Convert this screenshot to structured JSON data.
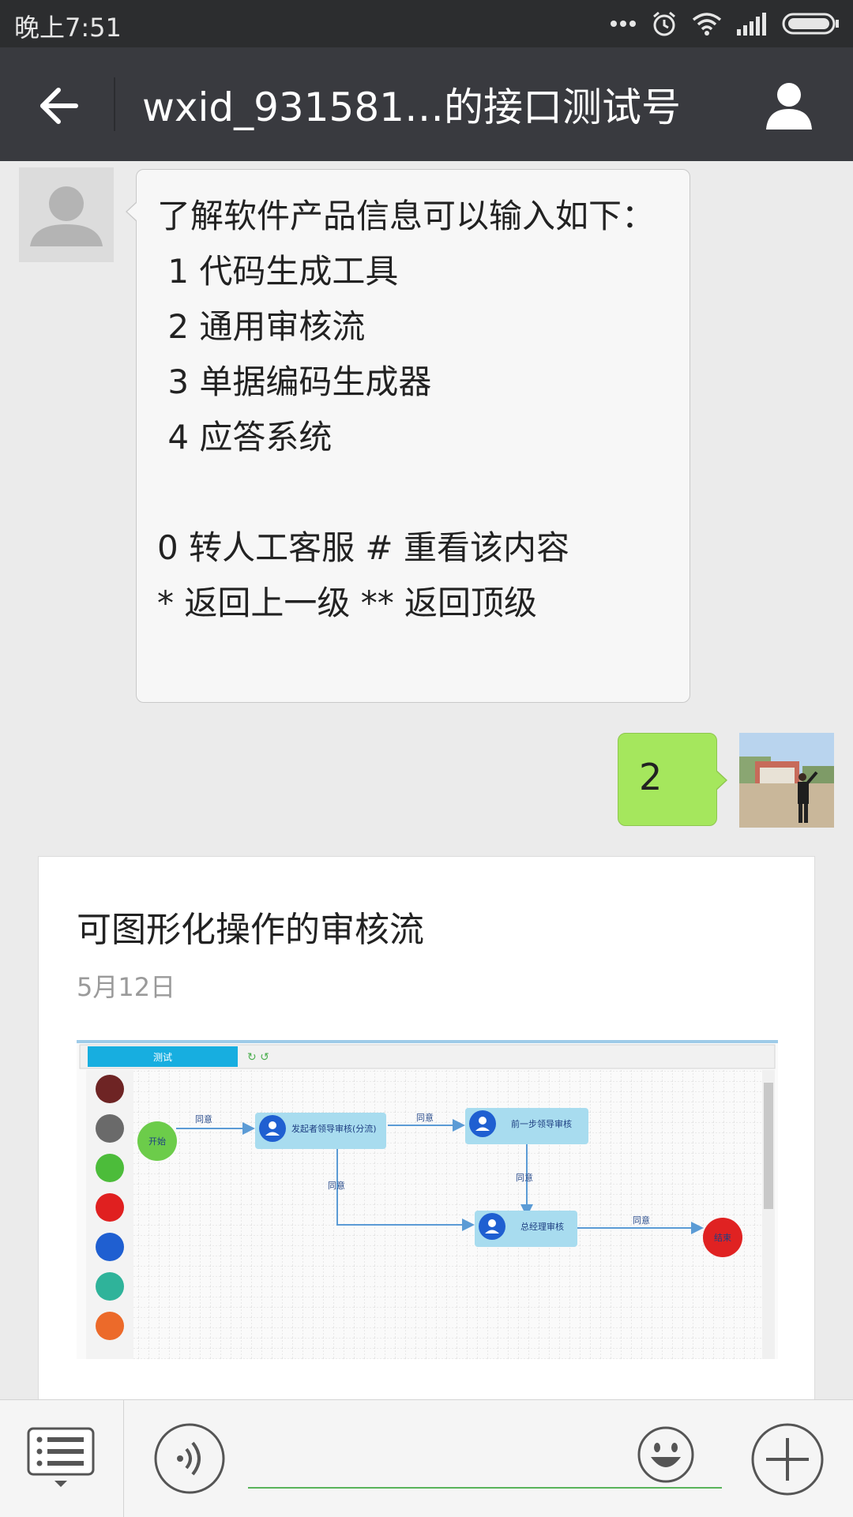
{
  "status_bar": {
    "time": "晚上7:51",
    "icons": [
      "more-dots-icon",
      "alarm-icon",
      "wifi-icon",
      "signal-icon",
      "battery-icon"
    ]
  },
  "header": {
    "title": "wxid_931581…的接口测试号",
    "icons": [
      "back-arrow-icon",
      "profile-icon"
    ],
    "background": "#393a3f"
  },
  "messages": [
    {
      "side": "left",
      "text": "了解软件产品信息可以输入如下：\n 1 代码生成工具\n 2 通用审核流\n 3 单据编码生成器\n 4 应答系统\n\n0 转人工客服 # 重看该内容\n* 返回上一级 ** 返回顶级"
    },
    {
      "side": "right",
      "text": "2",
      "bubble_color": "#a5e75d"
    }
  ],
  "article": {
    "title": "可图形化操作的审核流",
    "date": "5月12日",
    "image": {
      "tab": "测试",
      "nodes": [
        "开始",
        "发起者领导审核(分流)",
        "前一步领导审核",
        "总经理审核",
        "结束"
      ],
      "edge_label": "同意"
    }
  },
  "input_bar": {
    "icons": [
      "menu-list-icon",
      "voice-icon",
      "emoji-icon",
      "plus-icon"
    ],
    "accent": "#59b35a"
  }
}
